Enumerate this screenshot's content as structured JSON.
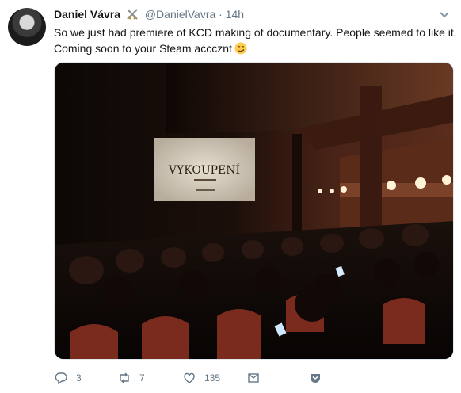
{
  "tweet": {
    "author_name": "Daniel Vávra",
    "handle": "@DanielVavra",
    "separator": "·",
    "time": "14h",
    "text_line1": "So we just had premiere of KCD making of documentary. People seemed to like it.",
    "text_line2": "Coming soon to your Steam acccznt",
    "emoji": "smirk-emoji"
  },
  "media": {
    "screen_title": "VYKOUPENÍ"
  },
  "actions": {
    "reply_count": "3",
    "retweet_count": "7",
    "like_count": "135"
  },
  "colors": {
    "text": "#14171a",
    "secondary": "#657786",
    "screen": "#d8cfc0",
    "hall": "#3b1e14"
  }
}
